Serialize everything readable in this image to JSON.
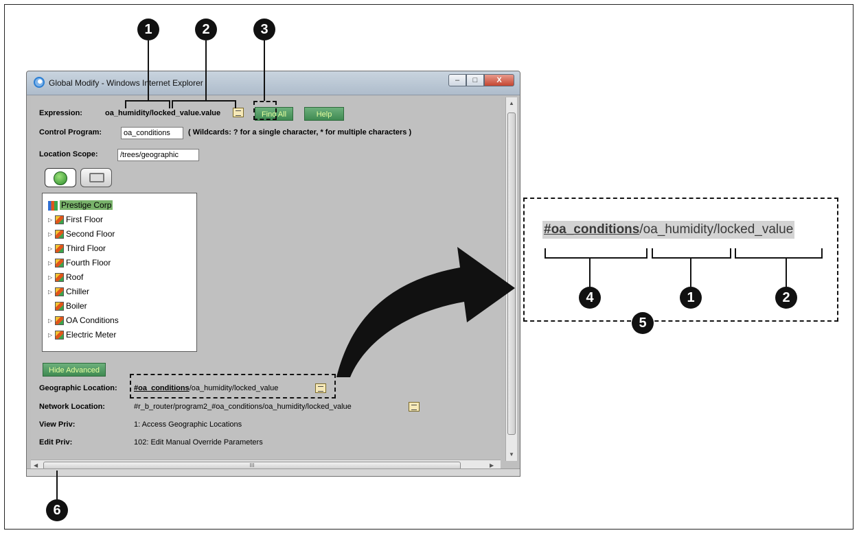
{
  "window": {
    "title": "Global Modify - Windows Internet Explorer",
    "controls": {
      "minimize": "–",
      "maximize": "□",
      "close": "X"
    }
  },
  "form": {
    "expression_label": "Expression:",
    "expression_value": "oa_humidity/locked_value.value",
    "find_all_label": "Find All",
    "help_label": "Help",
    "control_program_label": "Control Program:",
    "control_program_value": "oa_conditions",
    "wildcards_hint": "( Wildcards: ? for a single character, * for multiple characters )",
    "location_scope_label": "Location Scope:",
    "location_scope_value": "/trees/geographic"
  },
  "tree": {
    "items": [
      {
        "label": "Prestige Corp"
      },
      {
        "label": "First Floor"
      },
      {
        "label": "Second Floor"
      },
      {
        "label": "Third Floor"
      },
      {
        "label": "Fourth Floor"
      },
      {
        "label": "Roof"
      },
      {
        "label": "Chiller"
      },
      {
        "label": "Boiler"
      },
      {
        "label": "OA Conditions"
      },
      {
        "label": "Electric Meter"
      }
    ]
  },
  "advanced": {
    "hide_advanced_label": "Hide Advanced",
    "geographic_location_label": "Geographic Location:",
    "geographic_location_link": "#oa_conditions",
    "geographic_location_rest": "/oa_humidity/locked_value",
    "network_location_label": "Network Location:",
    "network_location_value": "#r_b_router/program2_#oa_conditions/oa_humidity/locked_value",
    "view_priv_label": "View Priv:",
    "view_priv_value": "1: Access Geographic Locations",
    "edit_priv_label": "Edit Priv:",
    "edit_priv_value": "102: Edit Manual Override Parameters"
  },
  "scroll": {
    "h_thumb_grip": "III"
  },
  "callouts": {
    "n1": "1",
    "n2": "2",
    "n3": "3",
    "n4": "4",
    "n5": "5",
    "n6": "6"
  },
  "zoom": {
    "link": "#oa_conditions",
    "rest": "/oa_humidity/locked_value"
  },
  "colors": {
    "button_green": "#3f8a52",
    "tree_root_highlight": "#79b36b",
    "window_background": "#c0c0c0"
  }
}
